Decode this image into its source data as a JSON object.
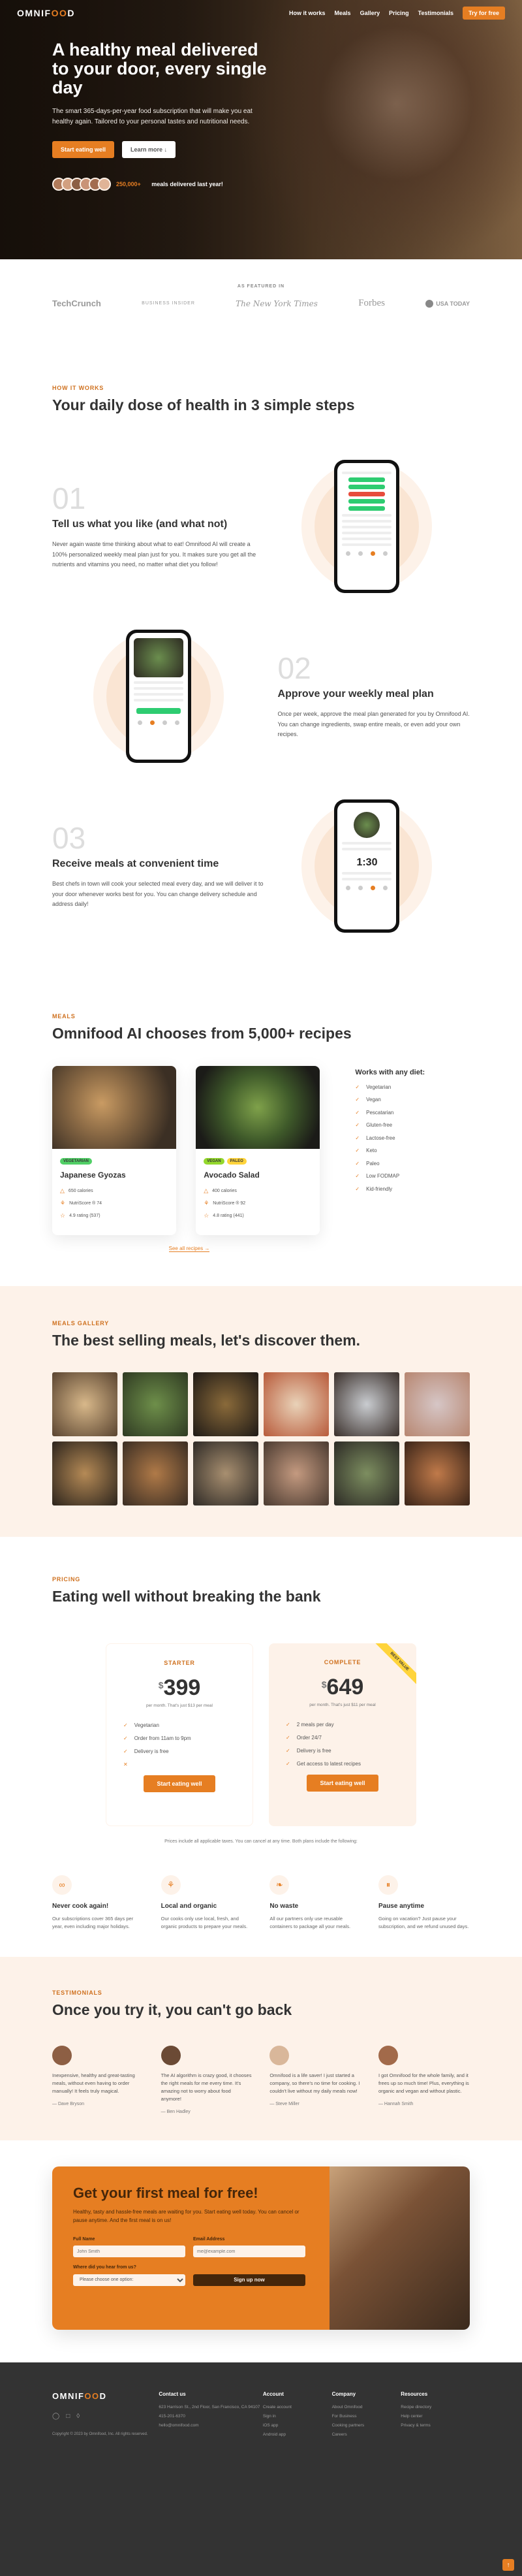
{
  "nav": {
    "logo_a": "OMNIF",
    "logo_o": "OO",
    "logo_b": "D",
    "links": [
      "How it works",
      "Meals",
      "Gallery",
      "Pricing",
      "Testimonials"
    ],
    "cta": "Try for free"
  },
  "hero": {
    "title": "A healthy meal delivered to your door, every single day",
    "text": "The smart 365-days-per-year food subscription that will make you eat healthy again. Tailored to your personal tastes and nutritional needs.",
    "btn_primary": "Start eating well",
    "btn_secondary": "Learn more ↓",
    "delivered_num": "250,000+",
    "delivered_text": " meals delivered last year!"
  },
  "featured": {
    "heading": "AS FEATURED IN",
    "logos": [
      "TechCrunch",
      "BUSINESS INSIDER",
      "The New York Times",
      "Forbes",
      "USA TODAY"
    ]
  },
  "how": {
    "sub": "How it works",
    "title": "Your daily dose of health in 3 simple steps",
    "steps": [
      {
        "num": "01",
        "title": "Tell us what you like (and what not)",
        "text": "Never again waste time thinking about what to eat! Omnifood AI will create a 100% personalized weekly meal plan just for you. It makes sure you get all the nutrients and vitamins you need, no matter what diet you follow!"
      },
      {
        "num": "02",
        "title": "Approve your weekly meal plan",
        "text": "Once per week, approve the meal plan generated for you by Omnifood AI. You can change ingredients, swap entire meals, or even add your own recipes."
      },
      {
        "num": "03",
        "title": "Receive meals at convenient time",
        "text": "Best chefs in town will cook your selected meal every day, and we will deliver it to your door whenever works best for you. You can change delivery schedule and address daily!"
      }
    ],
    "app_time": "1:30"
  },
  "meals": {
    "sub": "Meals",
    "title": "Omnifood AI chooses from 5,000+ recipes",
    "items": [
      {
        "tags": [
          "Vegetarian"
        ],
        "name": "Japanese Gyozas",
        "calories": "650 calories",
        "score": "NutriScore ® 74",
        "rating": "4.9 rating (537)"
      },
      {
        "tags": [
          "Vegan",
          "Paleo"
        ],
        "name": "Avocado Salad",
        "calories": "400 calories",
        "score": "NutriScore ® 92",
        "rating": "4.8 rating (441)"
      }
    ],
    "diet_title": "Works with any diet:",
    "diets": [
      "Vegetarian",
      "Vegan",
      "Pescatarian",
      "Gluten-free",
      "Lactose-free",
      "Keto",
      "Paleo",
      "Low FODMAP",
      "Kid-friendly"
    ],
    "all_link": "See all recipes →"
  },
  "gallery": {
    "sub": "Meals gallery",
    "title": "The best selling meals, let's discover them."
  },
  "pricing": {
    "sub": "Pricing",
    "title": "Eating well without breaking the bank",
    "plans": [
      {
        "name": "STARTER",
        "currency": "$",
        "price": "399",
        "per": "per month. That's just $13 per meal",
        "features": [
          "Vegetarian",
          "Order from 11am to 9pm",
          "Delivery is free",
          ""
        ],
        "btn": "Start eating well"
      },
      {
        "name": "COMPLETE",
        "currency": "$",
        "price": "649",
        "per": "per month. That's just $11 per meal",
        "features": [
          "2 meals per day",
          "Order 24/7",
          "Delivery is free",
          "Get access to latest recipes"
        ],
        "btn": "Start eating well",
        "ribbon": "BEST VALUE"
      }
    ],
    "note": "Prices include all applicable taxes. You can cancel at any time. Both plans include the following:",
    "features": [
      {
        "icon": "∞",
        "title": "Never cook again!",
        "text": "Our subscriptions cover 365 days per year, even including major holidays."
      },
      {
        "icon": "⚘",
        "title": "Local and organic",
        "text": "Our cooks only use local, fresh, and organic products to prepare your meals."
      },
      {
        "icon": "❧",
        "title": "No waste",
        "text": "All our partners only use reusable containers to package all your meals."
      },
      {
        "icon": "⏸",
        "title": "Pause anytime",
        "text": "Going on vacation? Just pause your subscription, and we refund unused days."
      }
    ]
  },
  "testimonials": {
    "sub": "Testimonials",
    "title": "Once you try it, you can't go back",
    "items": [
      {
        "text": "Inexpensive, healthy and great-tasting meals, without even having to order manually! It feels truly magical.",
        "who": "— Dave Bryson"
      },
      {
        "text": "The AI algorithm is crazy good, it chooses the right meals for me every time. It's amazing not to worry about food anymore!",
        "who": "— Ben Hadley"
      },
      {
        "text": "Omnifood is a life saver! I just started a company, so there's no time for cooking. I couldn't live without my daily meals now!",
        "who": "— Steve Miller"
      },
      {
        "text": "I got Omnifood for the whole family, and it frees up so much time! Plus, everything is organic and vegan and without plastic.",
        "who": "— Hannah Smith"
      }
    ]
  },
  "cta": {
    "title": "Get your first meal for free!",
    "text": "Healthy, tasty and hassle-free meals are waiting for you. Start eating well today. You can cancel or pause anytime. And the first meal is on us!",
    "name_label": "Full Name",
    "name_ph": "John Smith",
    "email_label": "Email Address",
    "email_ph": "me@example.com",
    "select_label": "Where did you hear from us?",
    "select_value": "Please choose one option:",
    "btn": "Sign up now"
  },
  "footer": {
    "copyright": "Copyright © 2023 by Omnifood, Inc. All rights reserved.",
    "contact_title": "Contact us",
    "address": "623 Harrison St., 2nd Floor, San Francisco, CA 94107",
    "phone": "415-201-6370",
    "email": "hello@omnifood.com",
    "cols": [
      {
        "title": "Account",
        "links": [
          "Create account",
          "Sign in",
          "iOS app",
          "Android app"
        ]
      },
      {
        "title": "Company",
        "links": [
          "About Omnifood",
          "For Business",
          "Cooking partners",
          "Careers"
        ]
      },
      {
        "title": "Resources",
        "links": [
          "Recipe directory",
          "Help center",
          "Privacy & terms"
        ]
      }
    ]
  },
  "colors": {
    "accent": "#e67e22",
    "accent_light": "#fdf2e9",
    "dark": "#333333"
  }
}
